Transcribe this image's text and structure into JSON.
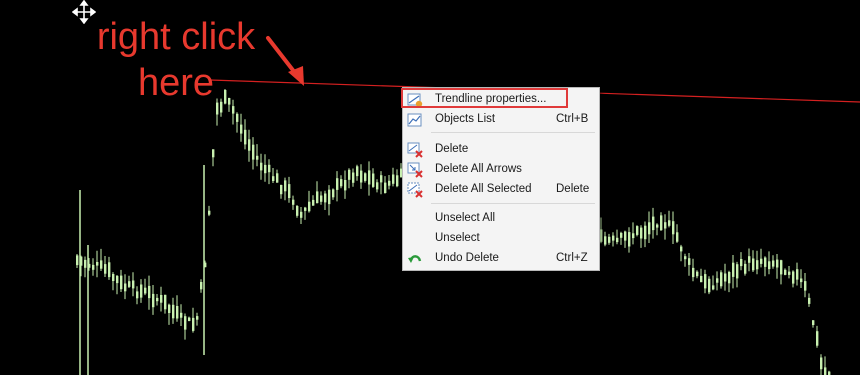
{
  "annotation": {
    "line1": "right click",
    "line2": "here"
  },
  "context_menu": {
    "items": [
      {
        "label": "Trendline properties...",
        "shortcut": "",
        "icon": "trendline-properties-icon"
      },
      {
        "label": "Objects List",
        "shortcut": "Ctrl+B",
        "icon": "objects-list-icon"
      },
      {
        "label": "Delete",
        "shortcut": "",
        "icon": "delete-icon"
      },
      {
        "label": "Delete All Arrows",
        "shortcut": "",
        "icon": "delete-all-arrows-icon"
      },
      {
        "label": "Delete All Selected",
        "shortcut": "Delete",
        "icon": "delete-all-selected-icon"
      },
      {
        "label": "Unselect All",
        "shortcut": "",
        "icon": ""
      },
      {
        "label": "Unselect",
        "shortcut": "",
        "icon": ""
      },
      {
        "label": "Undo Delete",
        "shortcut": "Ctrl+Z",
        "icon": "undo-icon"
      }
    ]
  },
  "colors": {
    "background": "#000000",
    "candle_bull": "#c8f0b0",
    "trendline": "#d42020",
    "annotation": "#e8392e",
    "highlight": "#e03a3a"
  },
  "icons": {
    "cursor": "move-cursor-icon"
  }
}
